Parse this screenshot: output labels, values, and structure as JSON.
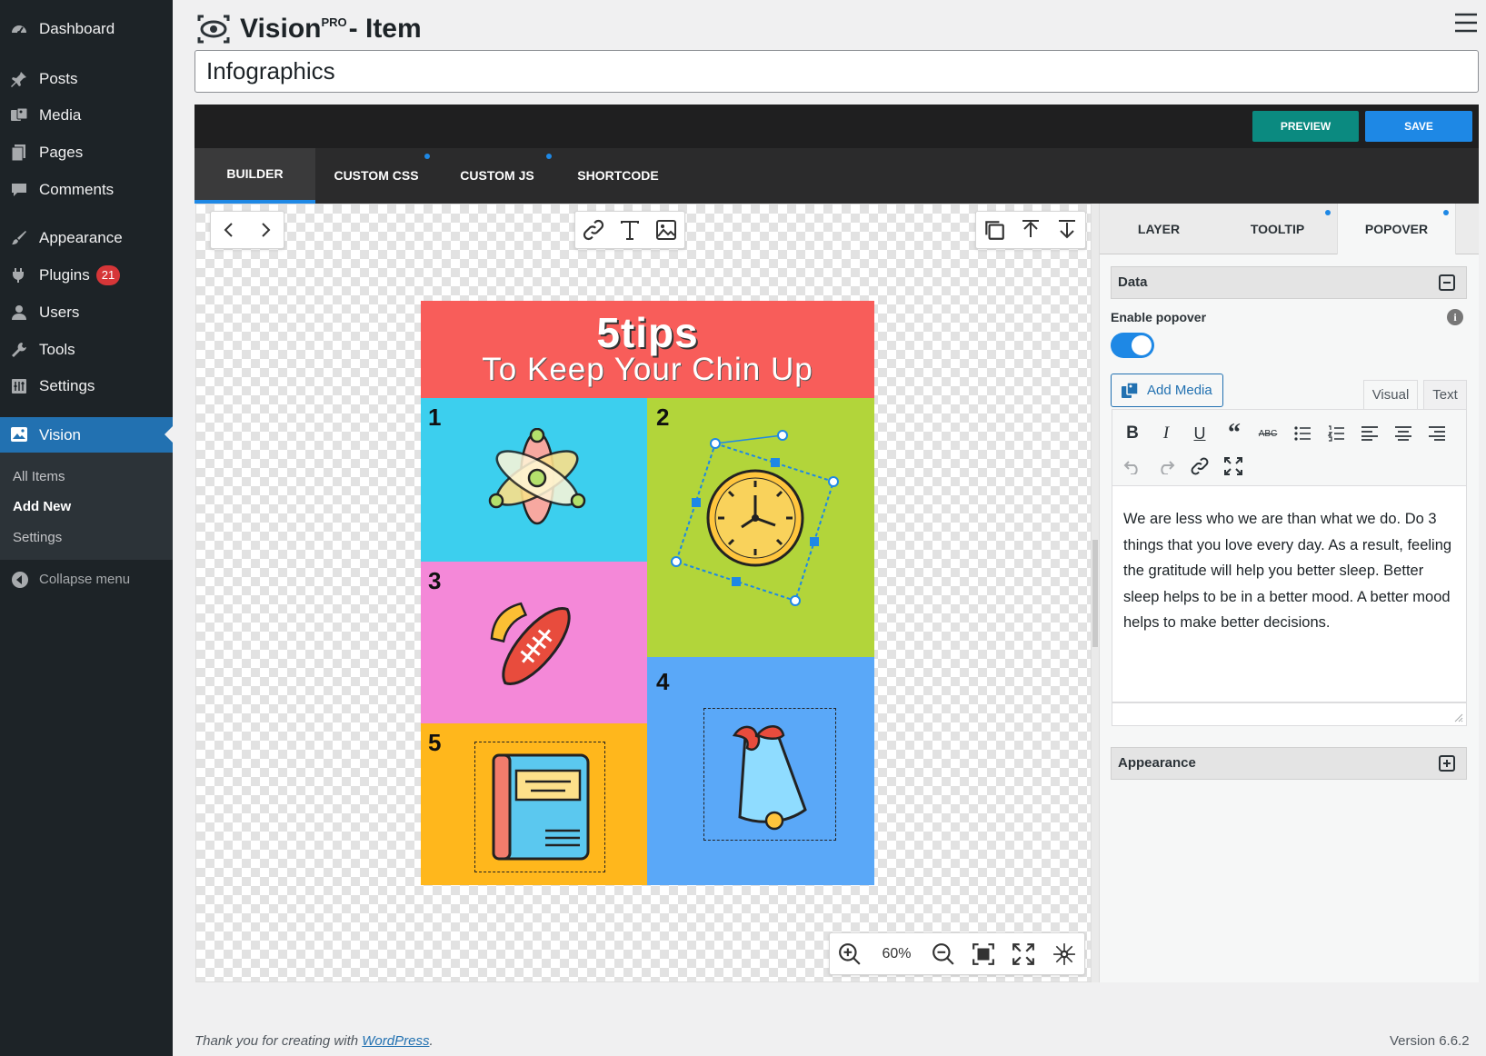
{
  "admin_menu": {
    "items": [
      {
        "label": "Dashboard",
        "icon": "dashboard-icon"
      },
      {
        "label": "Posts",
        "icon": "pushpin-icon"
      },
      {
        "label": "Media",
        "icon": "media-icon"
      },
      {
        "label": "Pages",
        "icon": "pages-icon"
      },
      {
        "label": "Comments",
        "icon": "comment-icon"
      },
      {
        "label": "Appearance",
        "icon": "paintbrush-icon"
      },
      {
        "label": "Plugins",
        "icon": "plugin-icon",
        "badge": "21"
      },
      {
        "label": "Users",
        "icon": "user-icon"
      },
      {
        "label": "Tools",
        "icon": "wrench-icon"
      },
      {
        "label": "Settings",
        "icon": "settings-icon"
      },
      {
        "label": "Vision",
        "icon": "vision-icon",
        "current": true
      }
    ],
    "submenu": [
      {
        "label": "All Items"
      },
      {
        "label": "Add New",
        "active": true
      },
      {
        "label": "Settings"
      }
    ],
    "collapse_label": "Collapse menu"
  },
  "header": {
    "title_prefix": "Vision",
    "title_super": "PRO",
    "title_suffix": " - Item",
    "item_title_value": "Infographics"
  },
  "toolbar": {
    "preview_label": "PREVIEW",
    "save_label": "SAVE",
    "preview_color": "#0b8a80",
    "save_color": "#1e88e5"
  },
  "editor_tabs": [
    {
      "label": "BUILDER",
      "active": true
    },
    {
      "label": "CUSTOM CSS",
      "dot": true
    },
    {
      "label": "CUSTOM JS",
      "dot": true
    },
    {
      "label": "SHORTCODE"
    }
  ],
  "canvas": {
    "zoom": "60%",
    "infographic": {
      "title": "5tips",
      "subtitle": "To Keep Your Chin Up",
      "cells": [
        {
          "number": "1",
          "icon": "atom-icon",
          "color": "#3ccfee"
        },
        {
          "number": "2",
          "icon": "clock-icon",
          "color": "#b2d53a"
        },
        {
          "number": "3",
          "icon": "football-icon",
          "color": "#f488d8"
        },
        {
          "number": "4",
          "icon": "bell-icon",
          "color": "#5aa8f8"
        },
        {
          "number": "5",
          "icon": "book-icon",
          "color": "#ffb71c"
        }
      ]
    }
  },
  "panel": {
    "tabs": [
      {
        "label": "LAYER"
      },
      {
        "label": "TOOLTIP",
        "dot": true
      },
      {
        "label": "POPOVER",
        "active": true,
        "dot": true
      }
    ],
    "data_section_title": "Data",
    "enable_popover_label": "Enable popover",
    "enable_popover_on": true,
    "add_media_label": "Add Media",
    "visual_tab_label": "Visual",
    "text_tab_label": "Text",
    "editor_text": "We are less who we are than what we do. Do 3 things that you love every day. As a result, feeling the gratitude will help you better sleep. Better sleep helps to be in a better mood. A better mood helps to make better decisions.",
    "appearance_section_title": "Appearance"
  },
  "footer": {
    "thanks_prefix": "Thank you for creating with ",
    "thanks_link": "WordPress",
    "thanks_suffix": ".",
    "version": "Version 6.6.2"
  }
}
